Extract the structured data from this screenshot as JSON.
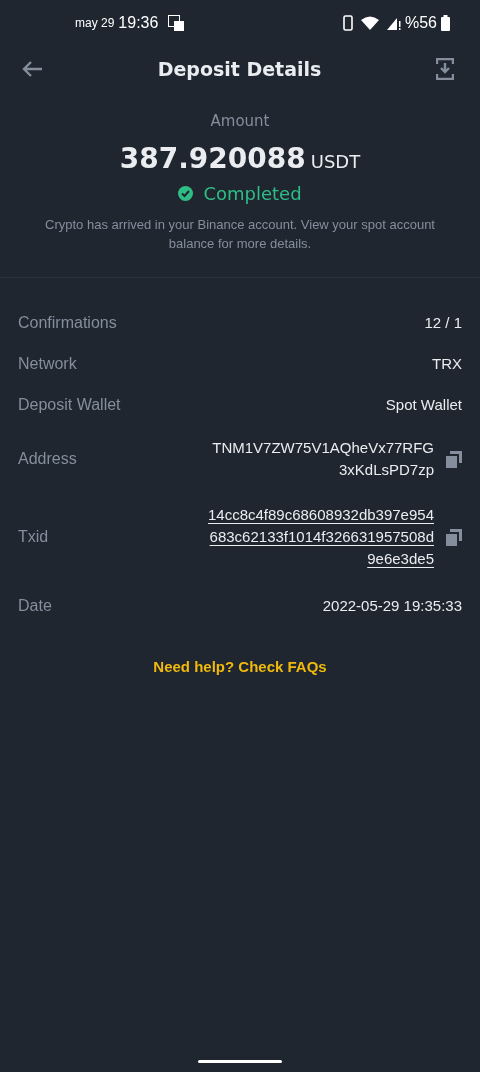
{
  "status_bar": {
    "date": "may 29",
    "time": "19:36",
    "battery": "%56"
  },
  "header": {
    "title": "Deposit Details"
  },
  "summary": {
    "label": "Amount",
    "amount": "387.920088",
    "currency": "USDT",
    "status": {
      "text": "Completed",
      "kind": "success"
    },
    "message": "Crypto has arrived in your Binance account. View your spot account balance for more details."
  },
  "details": [
    {
      "label": "Confirmations",
      "value": "12 / 1",
      "kind": "plain"
    },
    {
      "label": "Network",
      "value": "TRX",
      "kind": "plain"
    },
    {
      "label": "Deposit Wallet",
      "value": "Spot Wallet",
      "kind": "plain"
    },
    {
      "label": "Address",
      "value": "TNM1V7ZW75V1AQheVx77RFG3xKdLsPD7zp",
      "kind": "copy"
    },
    {
      "label": "Txid",
      "value": "14cc8c4f89c68608932db397e954683c62133f1014f326631957508d9e6e3de5",
      "kind": "link"
    },
    {
      "label": "Date",
      "value": "2022-05-29 19:35:33",
      "kind": "plain"
    }
  ],
  "help_link": "Need help? Check FAQs"
}
